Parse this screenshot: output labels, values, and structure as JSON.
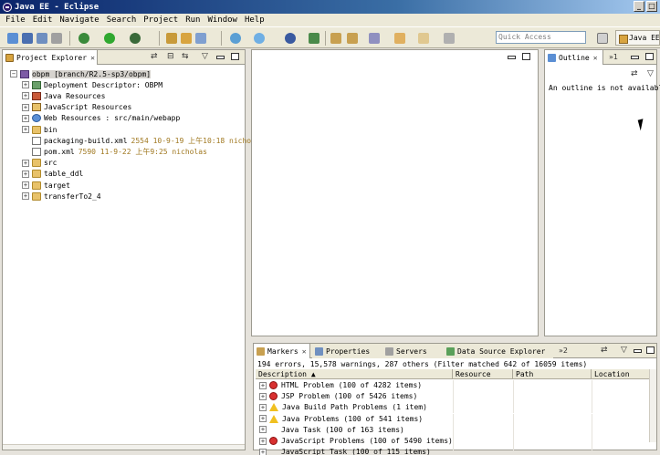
{
  "window": {
    "title": "Java EE - Eclipse"
  },
  "menu": [
    "File",
    "Edit",
    "Navigate",
    "Search",
    "Project",
    "Run",
    "Window",
    "Help"
  ],
  "toolbar": {
    "quick_access_placeholder": "Quick Access",
    "perspective_label": "Java EE"
  },
  "project_explorer": {
    "tab_label": "Project Explorer",
    "tree": [
      {
        "label": "obpm [branch/R2.5-sp3/obpm]",
        "meta": "",
        "level": 0,
        "expander": "-",
        "icon": "proj",
        "selected": true
      },
      {
        "label": "Deployment Descriptor: OBPM",
        "meta": "",
        "level": 1,
        "expander": "+",
        "icon": "dd"
      },
      {
        "label": "Java Resources",
        "meta": "",
        "level": 1,
        "expander": "+",
        "icon": "java"
      },
      {
        "label": "JavaScript Resources",
        "meta": "",
        "level": 1,
        "expander": "+",
        "icon": "js"
      },
      {
        "label": "Web Resources : src/main/webapp",
        "meta": "",
        "level": 1,
        "expander": "+",
        "icon": "globe"
      },
      {
        "label": "bin",
        "meta": "",
        "level": 1,
        "expander": "+",
        "icon": "folder"
      },
      {
        "label": "packaging-build.xml",
        "meta": "2554  10-9-19 上午10:18  nicholas",
        "level": 1,
        "expander": "",
        "icon": "file"
      },
      {
        "label": "pom.xml",
        "meta": "7590  11-9-22 上午9:25  nicholas",
        "level": 1,
        "expander": "",
        "icon": "file"
      },
      {
        "label": "src",
        "meta": "",
        "level": 1,
        "expander": "+",
        "icon": "folder"
      },
      {
        "label": "table_ddl",
        "meta": "",
        "level": 1,
        "expander": "+",
        "icon": "folder"
      },
      {
        "label": "target",
        "meta": "",
        "level": 1,
        "expander": "+",
        "icon": "folder"
      },
      {
        "label": "transferTo2_4",
        "meta": "",
        "level": 1,
        "expander": "+",
        "icon": "folder"
      }
    ]
  },
  "outline": {
    "tab_label": "Outline",
    "message": "An outline is not available.",
    "overflow": "»1"
  },
  "bottom_panel": {
    "tabs": [
      "Markers",
      "Properties",
      "Servers",
      "Data Source Explorer"
    ],
    "overflow": "»2",
    "summary": "194 errors, 15,578 warnings, 287 others (Filter matched 642 of 16059 items)",
    "columns": [
      "Description",
      "Resource",
      "Path",
      "Location"
    ],
    "rows": [
      {
        "severity": "error",
        "description": "HTML Problem (100 of 4282 items)"
      },
      {
        "severity": "error",
        "description": "JSP Problem (100 of 5426 items)"
      },
      {
        "severity": "warning",
        "description": "Java Build Path Problems (1 item)"
      },
      {
        "severity": "warning",
        "description": "Java Problems (100 of 541 items)"
      },
      {
        "severity": "task",
        "description": "Java Task (100 of 163 items)"
      },
      {
        "severity": "error",
        "description": "JavaScript Problems (100 of 5490 items)"
      },
      {
        "severity": "task",
        "description": "JavaScript Task (100 of 115 items)"
      }
    ]
  },
  "colors": {
    "titlebar_start": "#0a246a",
    "selection": "#d6d3ce",
    "error": "#d83030",
    "warning": "#f0c020",
    "meta_text": "#a07820"
  }
}
